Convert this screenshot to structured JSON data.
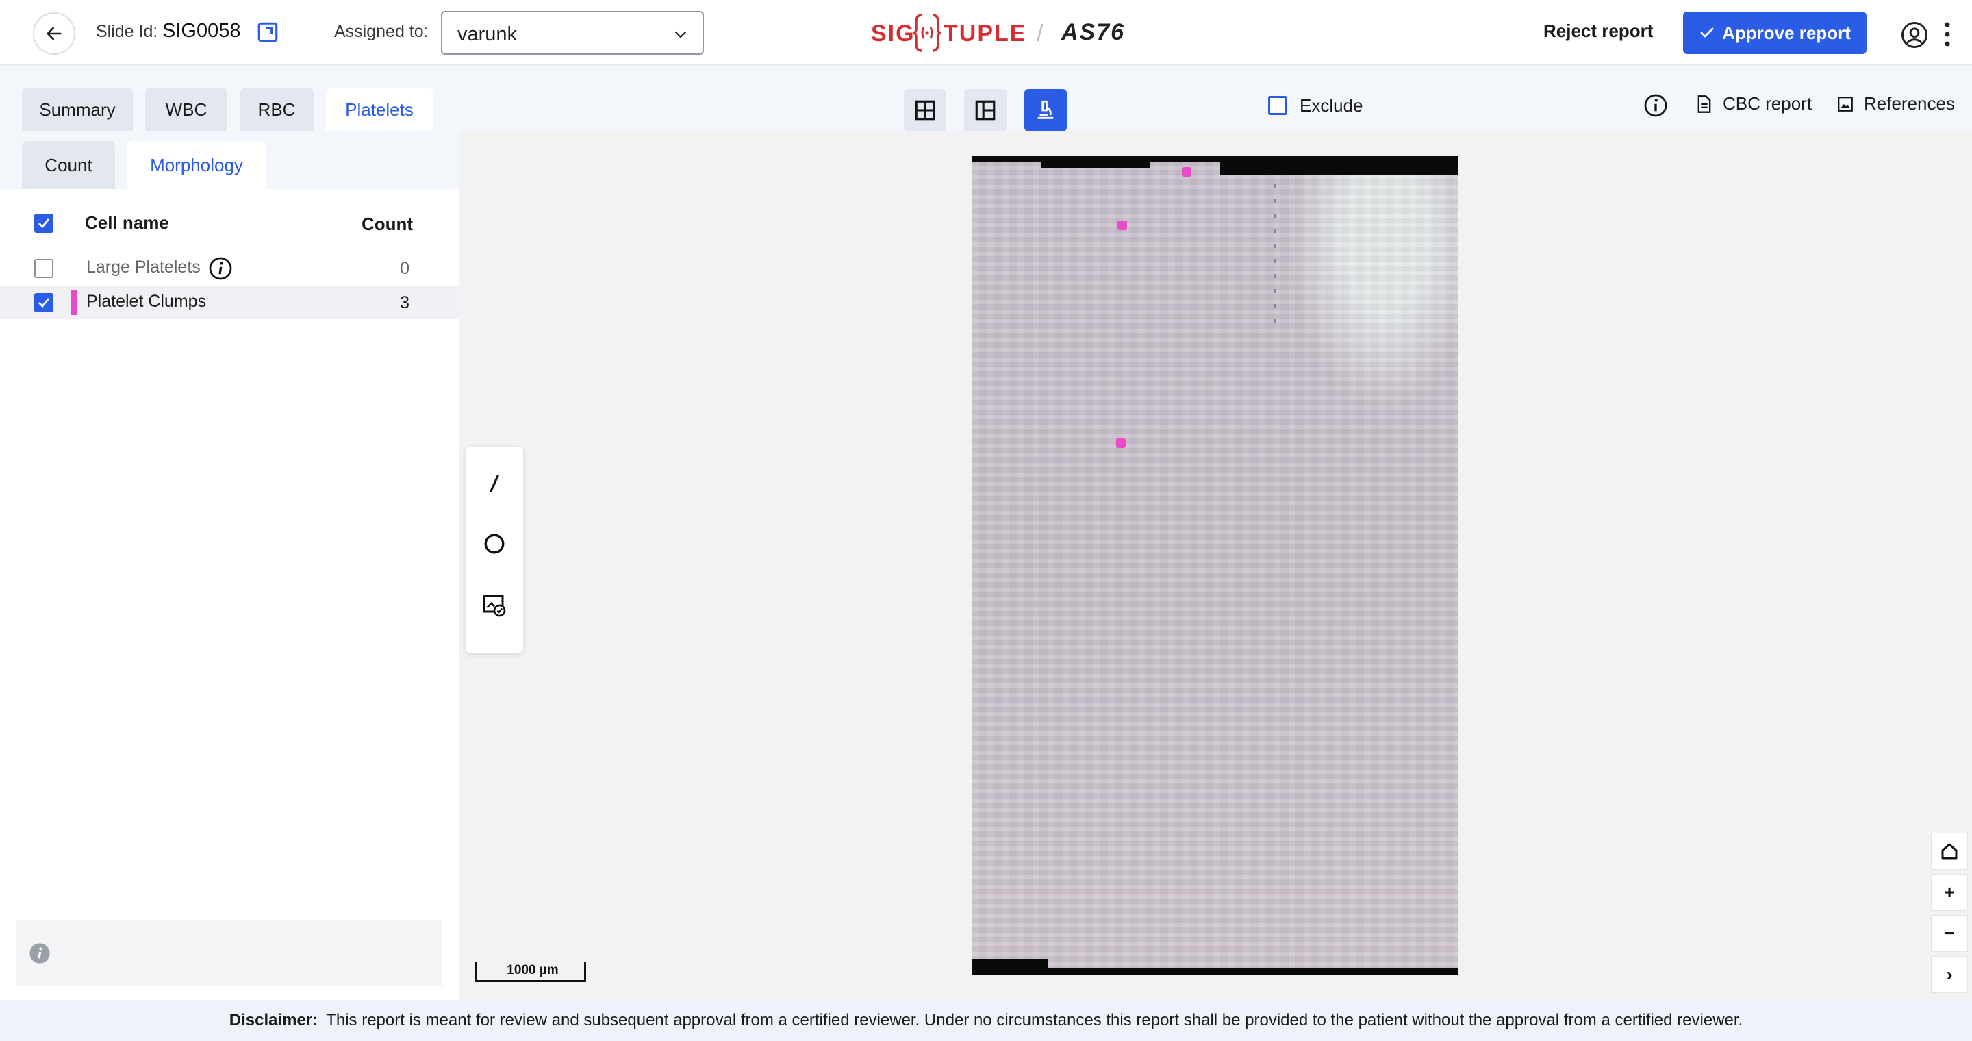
{
  "header": {
    "slide_label": "Slide Id:",
    "slide_id": "SIG0058",
    "assigned_label": "Assigned to:",
    "assigned_value": "varunk",
    "logo": {
      "brand_left": "SIG",
      "brand_right": "TUPLE",
      "separator": "/",
      "model": "AS76"
    },
    "reject_label": "Reject report",
    "approve_label": "Approve report",
    "accent_color": "#2b5ce6",
    "brand_color": "#d42e33"
  },
  "tabs": {
    "summary": "Summary",
    "wbc": "WBC",
    "rbc": "RBC",
    "platelets": "Platelets"
  },
  "toolbar": {
    "exclude_label": "Exclude",
    "cbc_label": "CBC report",
    "references_label": "References"
  },
  "left_panel": {
    "sub_tabs": {
      "count": "Count",
      "morphology": "Morphology"
    },
    "columns": {
      "cell_name": "Cell name",
      "count": "Count"
    },
    "cells": [
      {
        "name": "Large Platelets",
        "count": "0",
        "checked": false
      },
      {
        "name": "Platelet Clumps",
        "count": "3",
        "checked": true,
        "color": "#e84ac8"
      }
    ]
  },
  "viewer": {
    "scale_label": "1000 µm",
    "zoom": {
      "home": "⌂",
      "plus": "+",
      "minus": "−",
      "next": "›"
    }
  },
  "footer": {
    "disclaimer_label": "Disclaimer:",
    "disclaimer_text": "This report is meant for review and subsequent approval from a certified reviewer. Under no circumstances this report shall be provided to the patient without the approval from a certified reviewer."
  }
}
